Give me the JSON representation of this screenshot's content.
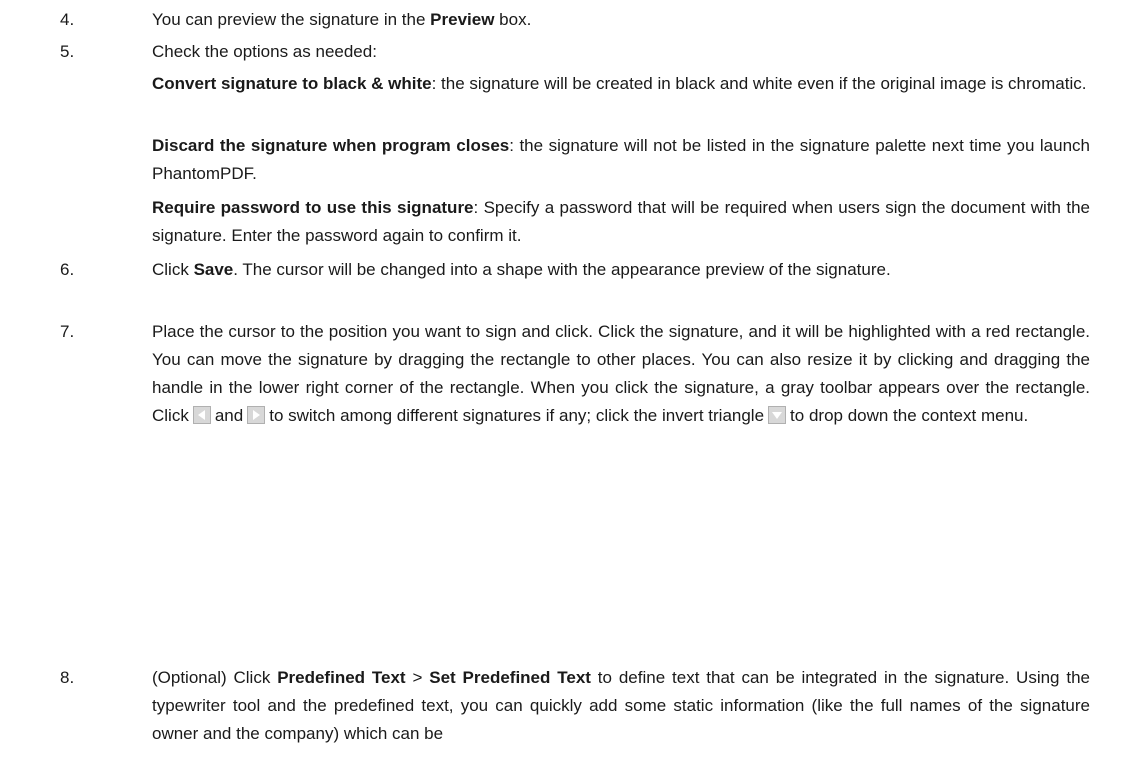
{
  "items": [
    {
      "num": "4.",
      "pre": "You can preview the signature in the ",
      "b1": "Preview",
      "post": " box."
    },
    {
      "num": "5.",
      "text": "Check the options as needed:"
    },
    {
      "opt1_b": "Convert signature to black & white",
      "opt1_t": ": the signature will be created in black and white even if the original image is chromatic."
    },
    {
      "opt2_b": "Discard the signature when program closes",
      "opt2_t": ": the signature will not be listed in the signature palette next time you launch PhantomPDF."
    },
    {
      "opt3_b": "Require password to use this signature",
      "opt3_t": ": Specify a password that will be required when users sign the document with the signature. Enter the password again to confirm it."
    },
    {
      "num": "6.",
      "pre": "Click ",
      "b1": "Save",
      "post": ". The cursor will be changed into a shape with the appearance preview of the signature."
    },
    {
      "num": "7.",
      "t1": "Place the cursor to the position you want to sign and click. Click the signature, and it will be highlighted with a red rectangle. You can move the signature by dragging the rectangle to other places. You can also resize it by clicking and dragging the handle in the lower right corner of the rectangle. When you click the signature, a gray toolbar appears over the rectangle. Click",
      "t2": "and",
      "t3": "to switch among different signatures if any; click the invert triangle",
      "t4": "to drop down the context menu."
    },
    {
      "num": "8.",
      "pre": "(Optional) Click ",
      "b1": "Predefined Text",
      "mid": " > ",
      "b2": "Set Predefined Text",
      "post": " to define text that can be integrated in the signature. Using the typewriter tool and the predefined text, you can quickly add some static information (like the full names of the signature owner and the company) which can be"
    }
  ],
  "icons": {
    "prev": "left-arrow-icon",
    "next": "right-arrow-icon",
    "menu": "invert-triangle-icon"
  }
}
